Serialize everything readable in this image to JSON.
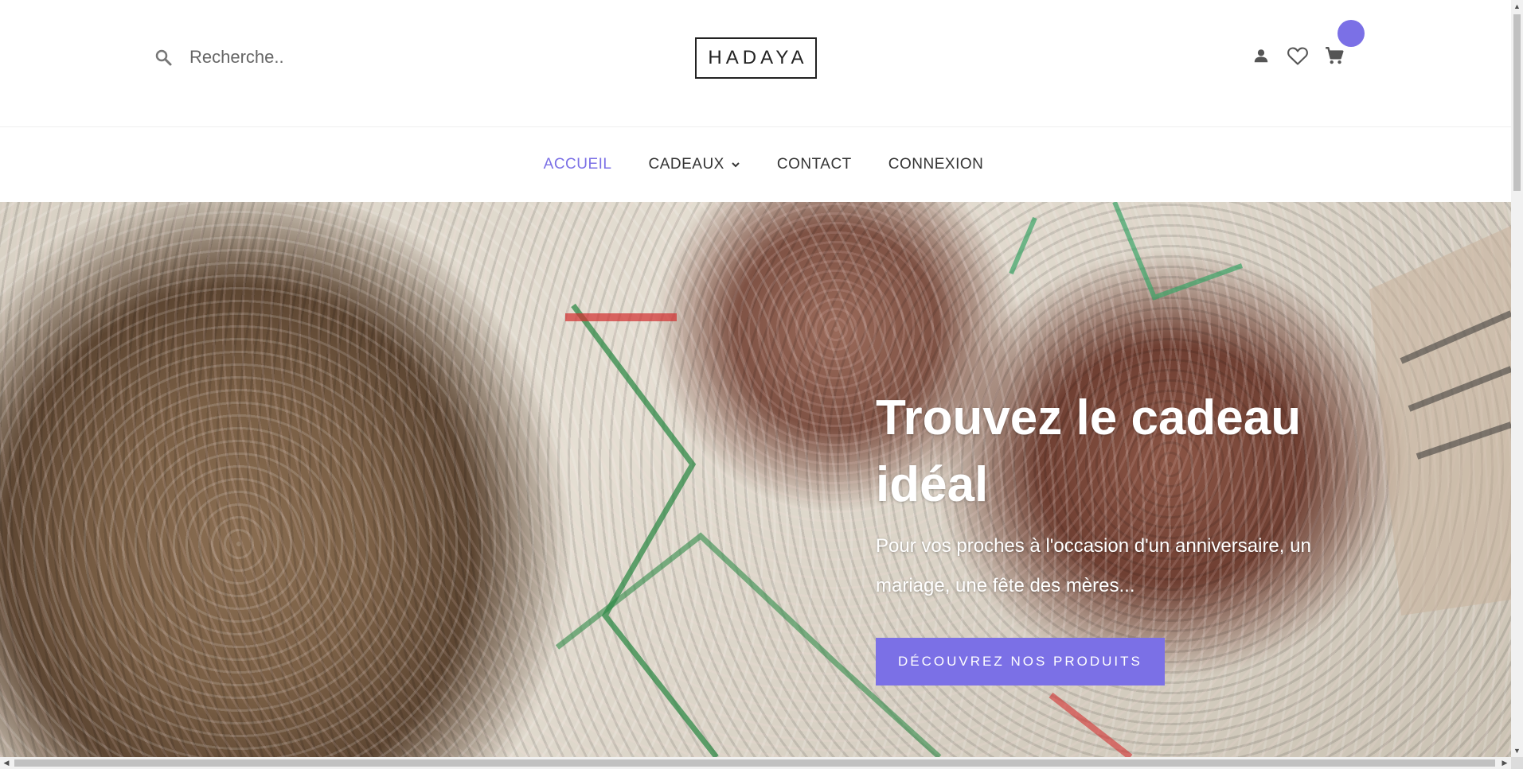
{
  "header": {
    "search": {
      "placeholder": "Recherche..",
      "icon": "search-icon"
    },
    "logo": "HADAYA",
    "actions": [
      {
        "icon": "account-icon"
      },
      {
        "icon": "heart-icon"
      },
      {
        "icon": "cart-icon"
      }
    ],
    "cart_badge_color": "#7b70e6"
  },
  "nav": {
    "items": [
      {
        "label": "ACCUEIL",
        "active": true
      },
      {
        "label": "CADEAUX",
        "has_dropdown": true
      },
      {
        "label": "CONTACT"
      },
      {
        "label": "CONNEXION"
      }
    ]
  },
  "hero": {
    "title": "Trouvez le cadeau idéal",
    "subtitle": "Pour vos proches à l'occasion d'un anniversaire, un mariage, une fête des mères...",
    "button_label": "DÉCOUVREZ NOS PRODUITS"
  },
  "colors": {
    "accent": "#7b70e6",
    "text": "#333333"
  }
}
